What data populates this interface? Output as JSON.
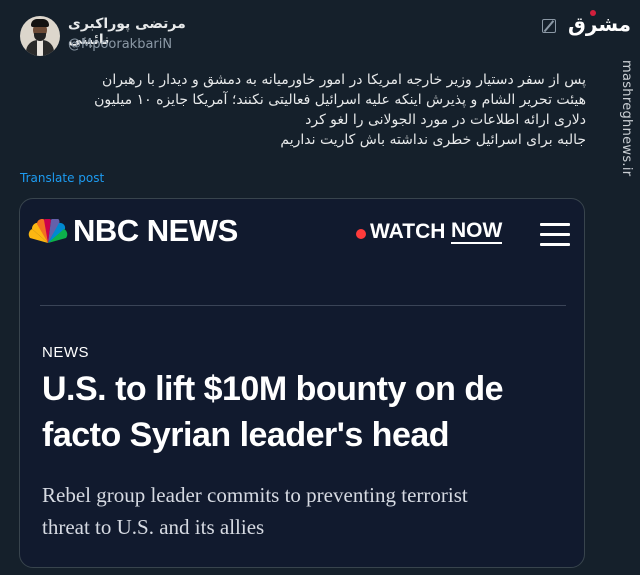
{
  "author": {
    "display_name": "مرتضی پوراکبری نائینی",
    "handle": "@MpoorakbariN"
  },
  "header_icons": [
    "grok-icon"
  ],
  "brand": {
    "logo_text": "مشرق",
    "watermark": "mashreghnews.ir"
  },
  "tweet": {
    "lines": [
      "پس از سفر  دستیار وزیر خارجه امریکا در امور خاورمیانه به دمشق و دیدار با رهبران",
      "هیئت تحریر الشام و پذیرش اینکه علیه اسرائیل فعالیتی نکنند؛ آمریکا جایزه ۱۰ میلیون",
      "دلاری ارائه اطلاعات در مورد الجولانی را لغو کرد",
      "جالبه برای اسرائیل خطری نداشته باش کاریت نداریم"
    ],
    "translate_label": "Translate post"
  },
  "card": {
    "outlet": "NBC NEWS",
    "watch_label": "WATCH",
    "now_label": "NOW",
    "section": "NEWS",
    "headline_lines": [
      "U.S. to lift $10M bounty on de",
      "facto Syrian leader's head"
    ],
    "subhead_lines": [
      "Rebel group leader commits to preventing terrorist",
      "threat to U.S. and its allies"
    ]
  },
  "colors": {
    "background": "#15202b",
    "card_bg": "#111a2e",
    "link": "#1d9bf0",
    "live_dot": "#ff3b3b",
    "logo_dot": "#d21f3c"
  }
}
